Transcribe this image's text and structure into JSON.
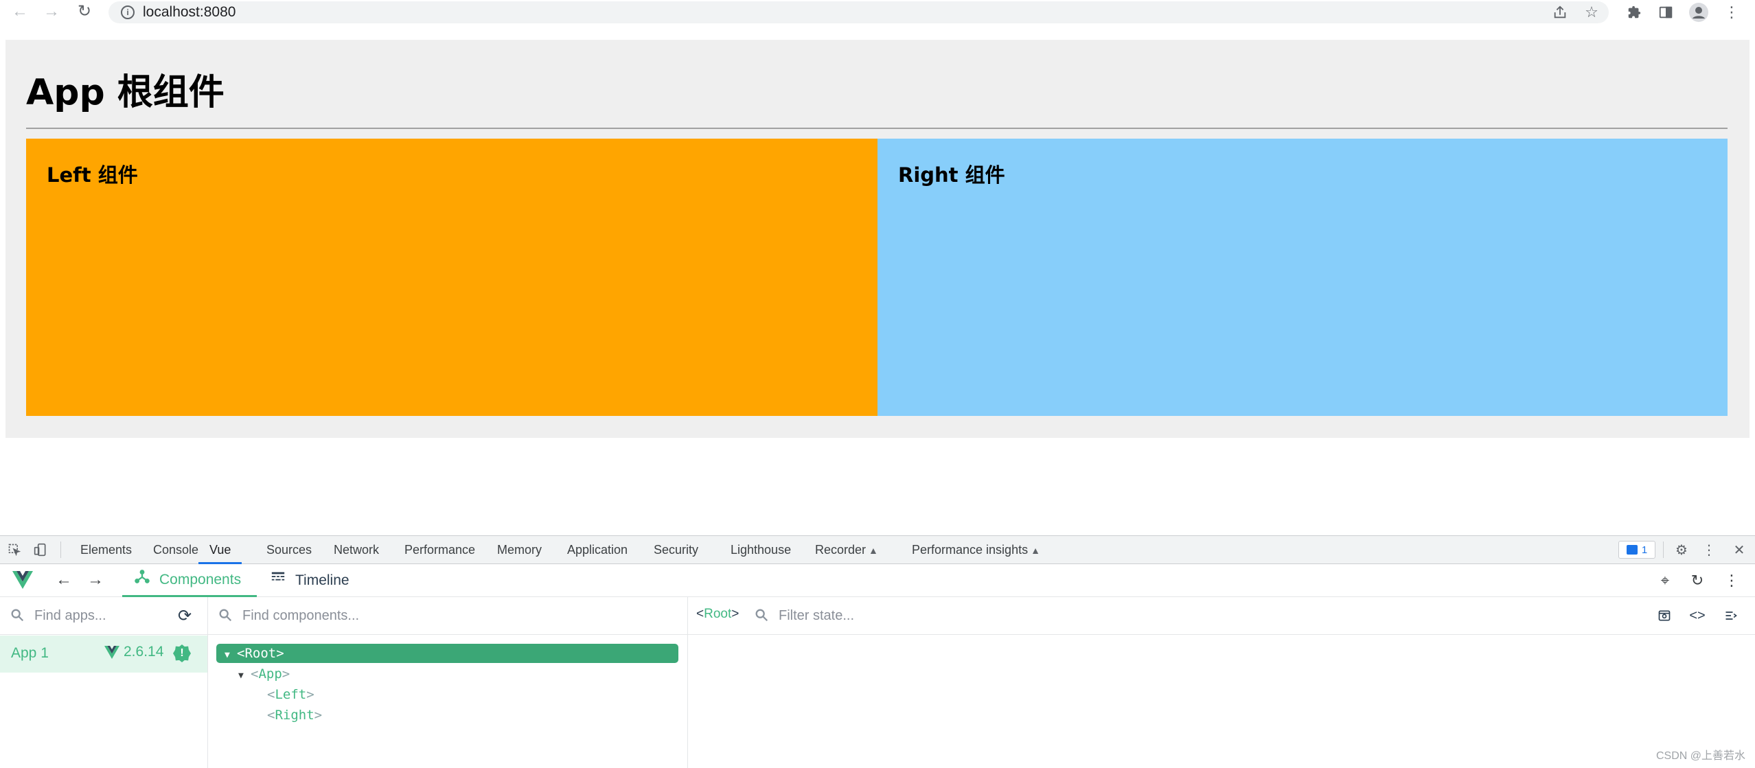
{
  "browser": {
    "url": "localhost:8080"
  },
  "page": {
    "app_title": "App 根组件",
    "left_title": "Left 组件",
    "right_title": "Right 组件",
    "colors": {
      "left": "#ffa500",
      "right": "#87cefa",
      "app_bg": "#efefef"
    }
  },
  "devtools": {
    "tabs": [
      {
        "label": "Elements"
      },
      {
        "label": "Console"
      },
      {
        "label": "Vue"
      },
      {
        "label": "Sources"
      },
      {
        "label": "Network"
      },
      {
        "label": "Performance"
      },
      {
        "label": "Memory"
      },
      {
        "label": "Application"
      },
      {
        "label": "Security"
      },
      {
        "label": "Lighthouse"
      },
      {
        "label": "Recorder"
      },
      {
        "label": "Performance insights"
      }
    ],
    "active_tab": "Vue",
    "issues_count": "1"
  },
  "vue": {
    "tabs": [
      {
        "label": "Components"
      },
      {
        "label": "Timeline"
      }
    ],
    "apps_search_placeholder": "Find apps...",
    "components_search_placeholder": "Find components...",
    "state_search_placeholder": "Filter state...",
    "app": {
      "name": "App 1",
      "version": "2.6.14",
      "badge": "!"
    },
    "tree": [
      {
        "open": "<",
        "name": "Root",
        "close": ">"
      },
      {
        "open": "<",
        "name": "App",
        "close": ">"
      },
      {
        "open": "<",
        "name": "Left",
        "close": ">"
      },
      {
        "open": "<",
        "name": "Right",
        "close": ">"
      }
    ],
    "state_crumb": {
      "open": "<",
      "name": "Root",
      "close": ">"
    },
    "accent": "#42b883"
  },
  "watermark": "CSDN @上善若水"
}
